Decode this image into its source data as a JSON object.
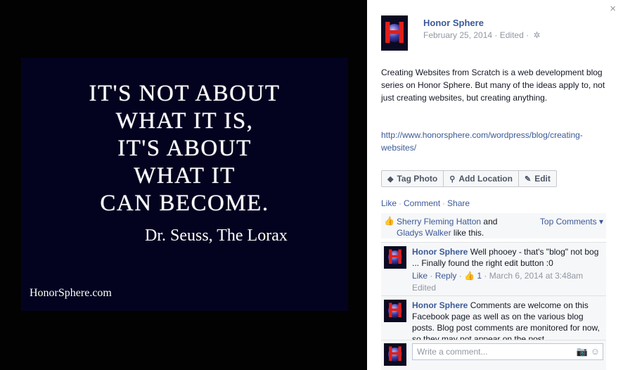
{
  "photo": {
    "quote_lines": [
      "It's not about",
      "what it is,",
      "it's about",
      "what it",
      "can become."
    ],
    "attribution": "Dr. Seuss, The Lorax",
    "watermark": "HonorSphere.com"
  },
  "post": {
    "page_name": "Honor Sphere",
    "date": "February 25, 2014",
    "edited": "Edited",
    "body": "Creating Websites from Scratch is a web development blog series on Honor Sphere. But many of the ideas apply to, not just creating websites, but creating anything.",
    "link": "http://www.honorsphere.com/wordpress/blog/creating-websites/",
    "actions": {
      "tag_photo": "Tag Photo",
      "add_location": "Add Location",
      "edit": "Edit"
    },
    "ufi": {
      "like": "Like",
      "comment": "Comment",
      "share": "Share"
    },
    "likes": {
      "user1": "Sherry Fleming Hatton",
      "and": "and",
      "user2": "Gladys Walker",
      "suffix": "like this.",
      "sort_label": "Top Comments"
    },
    "comments": [
      {
        "author": "Honor Sphere",
        "text": "Well phooey - that's \"blog\" not bog ... Finally found the right edit button :0",
        "like": "Like",
        "reply": "Reply",
        "like_count": "1",
        "time": "March 6, 2014 at 3:48am",
        "edited": "Edited"
      },
      {
        "author": "Honor Sphere",
        "text": "Comments are welcome on this Facebook page as well as on the various blog posts. Blog post comments are monitored for now, so they may not appear on the post"
      }
    ],
    "composer_placeholder": "Write a comment...",
    "close": "×"
  }
}
